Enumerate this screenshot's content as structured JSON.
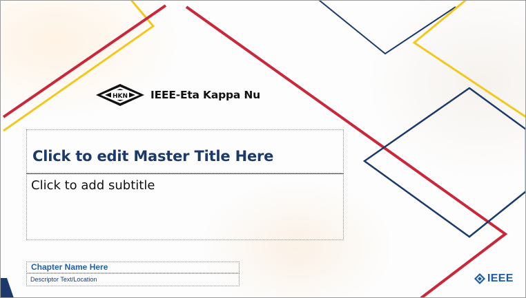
{
  "brand": {
    "organization_name": "IEEE-Eta Kappa Nu",
    "emblem_text": "HKN",
    "footer_logo_text": "IEEE"
  },
  "slide": {
    "title_placeholder": "Click to edit Master Title Here",
    "subtitle_placeholder": "Click to add subtitle",
    "chapter_name": "Chapter Name Here",
    "descriptor_text": "Descriptor Text/Location"
  },
  "colors": {
    "navy": "#1b3a6b",
    "red": "#c8283a",
    "gold": "#f2c81e",
    "ieee_blue": "#1b5aa6"
  },
  "icons": {
    "hkn_emblem": "hkn-diamond-icon",
    "ieee_emblem": "ieee-diamond-icon"
  }
}
